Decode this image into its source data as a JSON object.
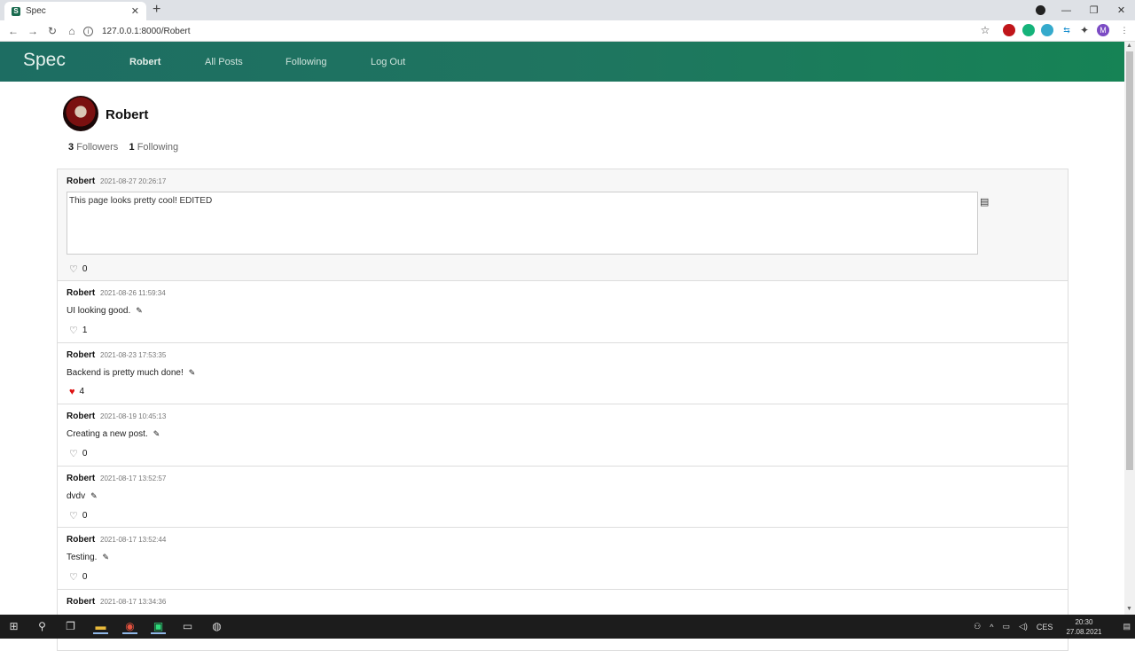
{
  "browser": {
    "tab_title": "Spec",
    "tab_favicon": "S",
    "url": "127.0.0.1:8000/Robert"
  },
  "site": {
    "brand": "Spec",
    "nav": [
      "Robert",
      "All Posts",
      "Following",
      "Log Out"
    ]
  },
  "profile": {
    "name": "Robert",
    "followers_count": "3",
    "followers_label": "Followers",
    "following_count": "1",
    "following_label": "Following"
  },
  "posts": [
    {
      "author": "Robert",
      "timestamp": "2021-08-27 20:26:17",
      "text": "This page looks pretty cool! EDITED",
      "likes": "0",
      "liked": false,
      "editing": true
    },
    {
      "author": "Robert",
      "timestamp": "2021-08-26 11:59:34",
      "text": "UI looking good.",
      "likes": "1",
      "liked": false
    },
    {
      "author": "Robert",
      "timestamp": "2021-08-23 17:53:35",
      "text": "Backend is pretty much done!",
      "likes": "4",
      "liked": true
    },
    {
      "author": "Robert",
      "timestamp": "2021-08-19 10:45:13",
      "text": "Creating a new post.",
      "likes": "0",
      "liked": false
    },
    {
      "author": "Robert",
      "timestamp": "2021-08-17 13:52:57",
      "text": "dvdv",
      "likes": "0",
      "liked": false
    },
    {
      "author": "Robert",
      "timestamp": "2021-08-17 13:52:44",
      "text": "Testing.",
      "likes": "0",
      "liked": false
    },
    {
      "author": "Robert",
      "timestamp": "2021-08-17 13:34:36",
      "text": "",
      "likes": "",
      "liked": false
    }
  ],
  "taskbar": {
    "lang": "CES",
    "time": "20:30",
    "date": "27.08.2021"
  },
  "colors": {
    "nav_gradient_start": "#1d6d62",
    "nav_gradient_end": "#168355",
    "liked_heart": "#dd1111"
  }
}
